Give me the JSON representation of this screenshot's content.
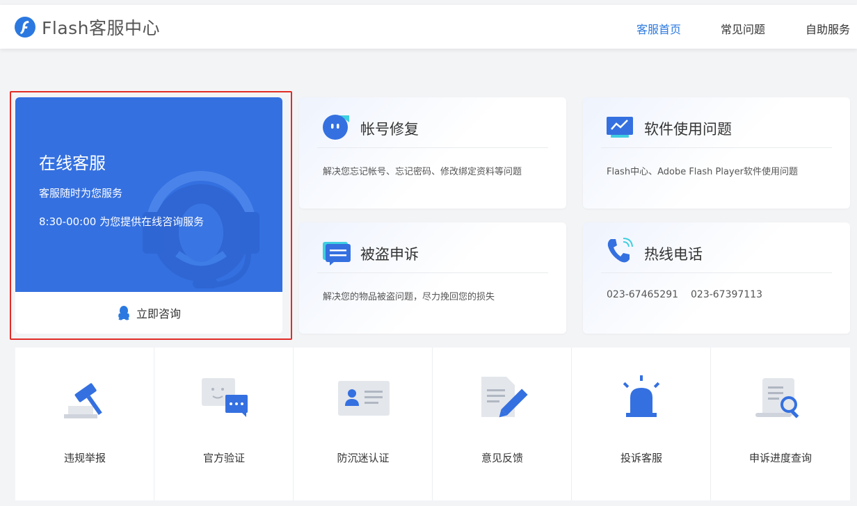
{
  "header": {
    "logo_text": "Flash客服中心",
    "nav": [
      {
        "label": "客服首页",
        "active": true
      },
      {
        "label": "常见问题",
        "active": false
      },
      {
        "label": "自助服务",
        "active": false
      }
    ]
  },
  "online_service": {
    "title": "在线客服",
    "subtitle": "客服随时为您服务",
    "hours": "8:30-00:00 为您提供在线咨询服务",
    "button_label": "立即咨询"
  },
  "cards": [
    {
      "title": "帐号修复",
      "desc": "解决您忘记帐号、忘记密码、修改绑定资料等问题",
      "icon": "account-repair-icon"
    },
    {
      "title": "软件使用问题",
      "desc": "Flash中心、Adobe Flash Player软件使用问题",
      "icon": "monitor-chart-icon"
    },
    {
      "title": "被盗申诉",
      "desc": "解决您的物品被盗问题，尽力挽回您的损失",
      "icon": "chat-message-icon"
    },
    {
      "title": "热线电话",
      "phones": [
        "023-67465291",
        "023-67397113"
      ],
      "icon": "phone-icon"
    }
  ],
  "tiles": [
    {
      "label": "违规举报",
      "icon": "gavel-icon"
    },
    {
      "label": "官方验证",
      "icon": "chat-bubbles-icon"
    },
    {
      "label": "防沉迷认证",
      "icon": "id-card-icon"
    },
    {
      "label": "意见反馈",
      "icon": "document-pen-icon"
    },
    {
      "label": "投诉客服",
      "icon": "alarm-light-icon"
    },
    {
      "label": "申诉进度查询",
      "icon": "scroll-search-icon"
    }
  ],
  "colors": {
    "primary": "#3470e0",
    "nav_active": "#2b79e0",
    "highlight_border": "#e22b25",
    "background": "#f3f4f6"
  }
}
